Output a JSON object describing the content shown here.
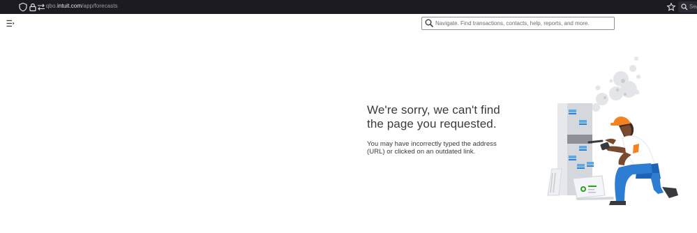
{
  "browser": {
    "url_prefix": "qbo.",
    "url_domain": "intuit.com",
    "url_path": "/app/forecasts",
    "search_label": "Sea"
  },
  "header": {
    "search_placeholder": "Navigate. Find transactions, contacts, help, reports, and more."
  },
  "error": {
    "title_line1": "We're sorry, we can't find",
    "title_line2": "the page you requested.",
    "body_line1": "You may have incorrectly typed the address",
    "body_line2": "(URL) or clicked on an outdated link."
  },
  "colors": {
    "browser_bg": "#1c1b22",
    "text": "#393a3d",
    "accent_orange": "#f58220",
    "accent_blue": "#2d7dd2",
    "server_gray": "#d4d7dc",
    "accent_green": "#2ca01c"
  },
  "icons": [
    "shield-icon",
    "lock-icon",
    "permissions-icon",
    "bookmark-star-icon",
    "search-icon",
    "menu-collapse-icon",
    "magnifier-icon"
  ]
}
